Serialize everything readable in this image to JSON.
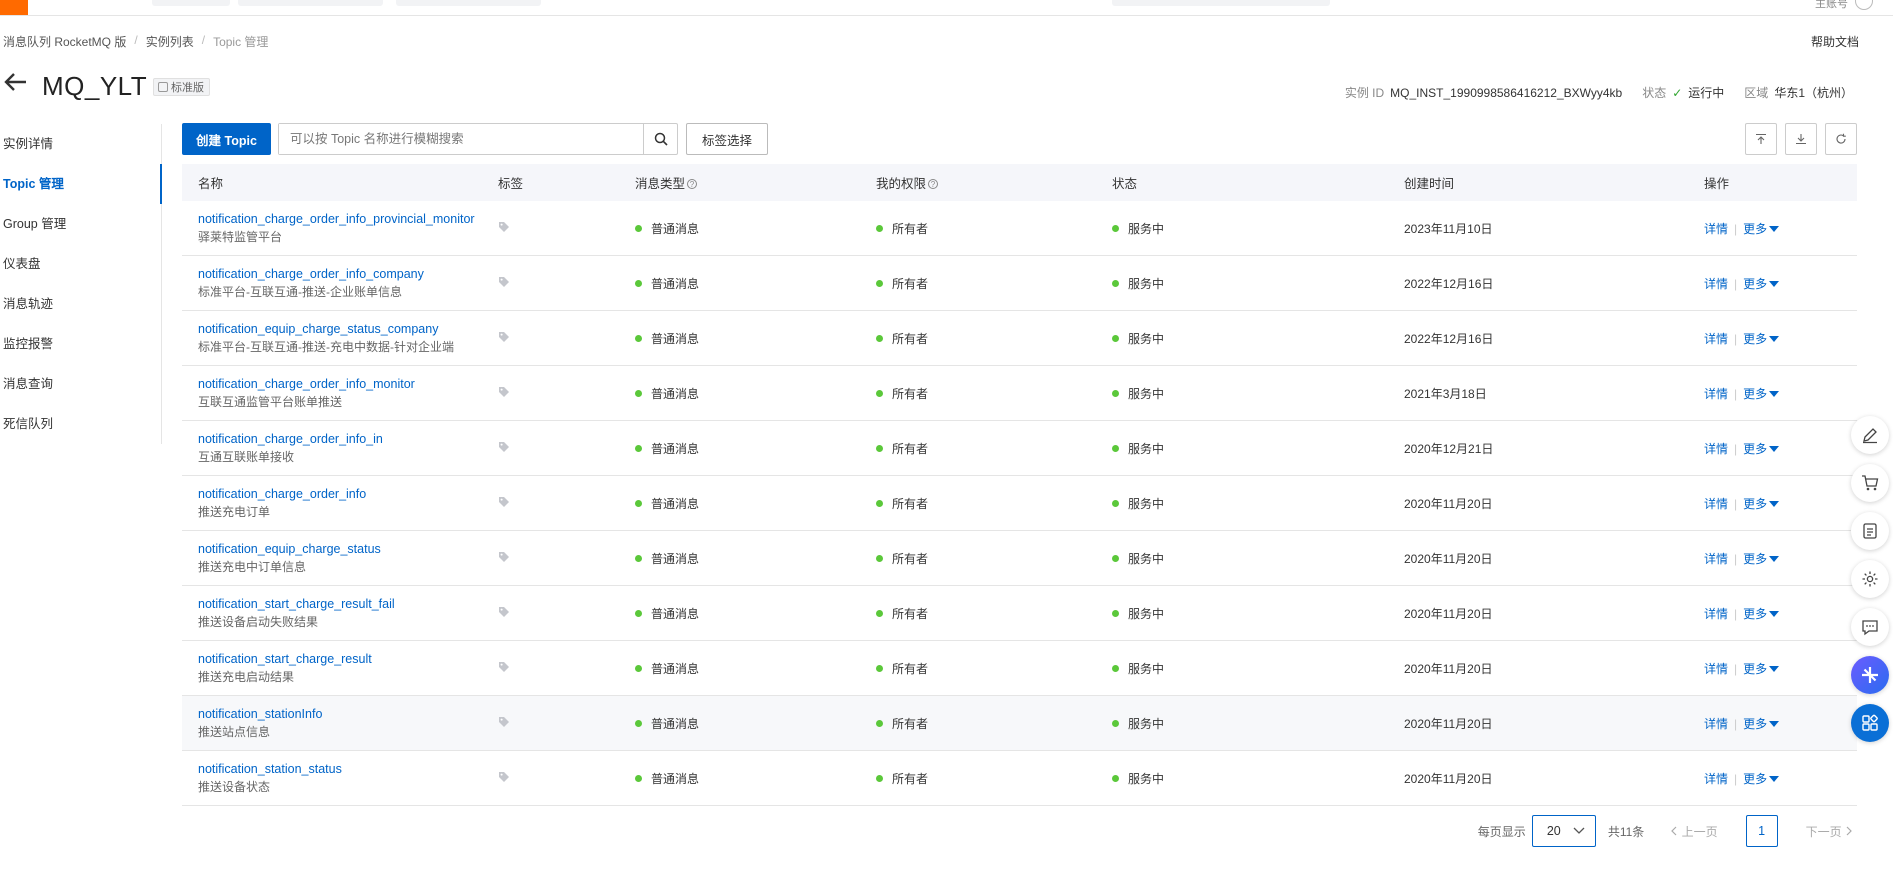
{
  "topbar": {
    "account": "主账号"
  },
  "breadcrumb": {
    "items": [
      "消息队列 RocketMQ 版",
      "实例列表",
      "Topic 管理"
    ]
  },
  "help_link": "帮助文档",
  "header": {
    "title": "MQ_YLT",
    "edition": "标准版",
    "instance_id_label": "实例 ID",
    "instance_id": "MQ_INST_1990998586416212_BXWyy4kb",
    "status_label": "状态",
    "status": "运行中",
    "region_label": "区域",
    "region": "华东1（杭州）"
  },
  "sidenav": {
    "items": [
      "实例详情",
      "Topic 管理",
      "Group 管理",
      "仪表盘",
      "消息轨迹",
      "监控报警",
      "消息查询",
      "死信队列"
    ],
    "active_index": 1
  },
  "toolbar": {
    "create_label": "创建 Topic",
    "search_placeholder": "可以按 Topic 名称进行模糊搜索",
    "tag_select_label": "标签选择"
  },
  "table": {
    "columns": [
      "名称",
      "标签",
      "消息类型",
      "我的权限",
      "状态",
      "创建时间",
      "操作"
    ],
    "rows": [
      {
        "name": "notification_charge_order_info_provincial_monitor",
        "desc": "驿莱特监管平台",
        "type": "普通消息",
        "perm": "所有者",
        "status": "服务中",
        "created": "2023年11月10日"
      },
      {
        "name": "notification_charge_order_info_company",
        "desc": "标准平台-互联互通-推送-企业账单信息",
        "type": "普通消息",
        "perm": "所有者",
        "status": "服务中",
        "created": "2022年12月16日"
      },
      {
        "name": "notification_equip_charge_status_company",
        "desc": "标准平台-互联互通-推送-充电中数据-针对企业端",
        "type": "普通消息",
        "perm": "所有者",
        "status": "服务中",
        "created": "2022年12月16日"
      },
      {
        "name": "notification_charge_order_info_monitor",
        "desc": "互联互通监管平台账单推送",
        "type": "普通消息",
        "perm": "所有者",
        "status": "服务中",
        "created": "2021年3月18日"
      },
      {
        "name": "notification_charge_order_info_in",
        "desc": "互通互联账单接收",
        "type": "普通消息",
        "perm": "所有者",
        "status": "服务中",
        "created": "2020年12月21日"
      },
      {
        "name": "notification_charge_order_info",
        "desc": "推送充电订单",
        "type": "普通消息",
        "perm": "所有者",
        "status": "服务中",
        "created": "2020年11月20日"
      },
      {
        "name": "notification_equip_charge_status",
        "desc": "推送充电中订单信息",
        "type": "普通消息",
        "perm": "所有者",
        "status": "服务中",
        "created": "2020年11月20日"
      },
      {
        "name": "notification_start_charge_result_fail",
        "desc": "推送设备启动失败结果",
        "type": "普通消息",
        "perm": "所有者",
        "status": "服务中",
        "created": "2020年11月20日"
      },
      {
        "name": "notification_start_charge_result",
        "desc": "推送充电启动结果",
        "type": "普通消息",
        "perm": "所有者",
        "status": "服务中",
        "created": "2020年11月20日"
      },
      {
        "name": "notification_stationInfo",
        "desc": "推送站点信息",
        "type": "普通消息",
        "perm": "所有者",
        "status": "服务中",
        "created": "2020年11月20日"
      },
      {
        "name": "notification_station_status",
        "desc": "推送设备状态",
        "type": "普通消息",
        "perm": "所有者",
        "status": "服务中",
        "created": "2020年11月20日"
      }
    ],
    "op_detail": "详情",
    "op_more": "更多"
  },
  "pagination": {
    "per_page_label": "每页显示",
    "page_size": "20",
    "total": "共11条",
    "prev": "上一页",
    "current_page": "1",
    "next": "下一页"
  },
  "colors": {
    "primary": "#0064c8",
    "status_green": "#5bc83a",
    "brand_orange": "#ff6a00"
  }
}
